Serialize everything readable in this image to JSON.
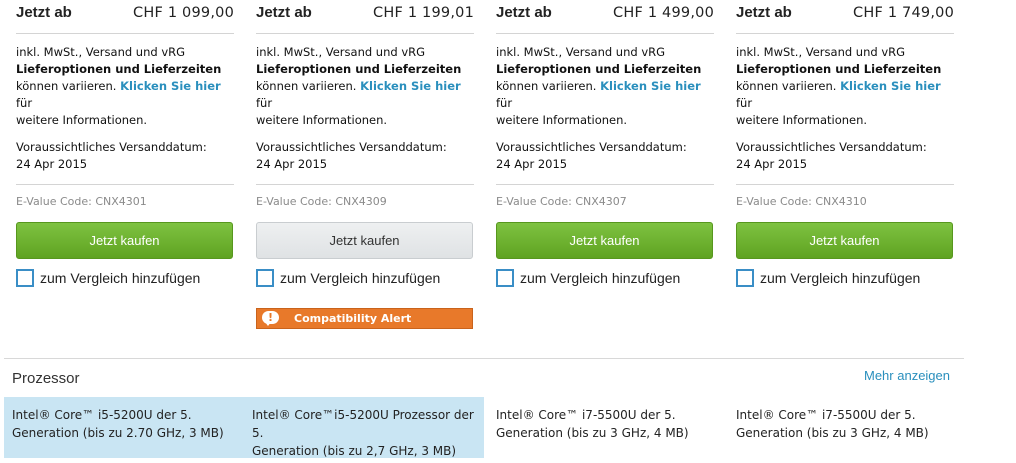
{
  "products": [
    {
      "lead": "Jetzt ab",
      "price": "CHF 1 099,00",
      "info_line1": "inkl. MwSt., Versand und vRG",
      "info_line2": "Lieferoptionen und Lieferzeiten",
      "info_line3_a": "können variieren.",
      "info_link": "Klicken Sie hier",
      "info_line3_b": "für",
      "info_line4": "weitere Informationen.",
      "ship_label": "Voraussichtliches Versanddatum:",
      "ship_date": "24 Apr 2015",
      "ecode": "E-Value Code: CNX4301",
      "buy_label": "Jetzt kaufen",
      "compare_label": "zum Vergleich hinzufügen"
    },
    {
      "lead": "Jetzt ab",
      "price": "CHF 1 199,01",
      "info_line1": "inkl. MwSt., Versand und vRG",
      "info_line2": "Lieferoptionen und Lieferzeiten",
      "info_line3_a": "können variieren.",
      "info_link": "Klicken Sie hier",
      "info_line3_b": "für",
      "info_line4": "weitere Informationen.",
      "ship_label": "Voraussichtliches Versanddatum:",
      "ship_date": "24 Apr 2015",
      "ecode": "E-Value Code: CNX4309",
      "buy_label": "Jetzt kaufen",
      "compare_label": "zum Vergleich hinzufügen",
      "alert_label": "Compatibility Alert",
      "alert_glyph": "!"
    },
    {
      "lead": "Jetzt ab",
      "price": "CHF 1 499,00",
      "info_line1": "inkl. MwSt., Versand und vRG",
      "info_line2": "Lieferoptionen und Lieferzeiten",
      "info_line3_a": "können variieren.",
      "info_link": "Klicken Sie hier",
      "info_line3_b": "für",
      "info_line4": "weitere Informationen.",
      "ship_label": "Voraussichtliches Versanddatum:",
      "ship_date": "24 Apr 2015",
      "ecode": "E-Value Code: CNX4307",
      "buy_label": "Jetzt kaufen",
      "compare_label": "zum Vergleich hinzufügen"
    },
    {
      "lead": "Jetzt ab",
      "price": "CHF 1 749,00",
      "info_line1": "inkl. MwSt., Versand und vRG",
      "info_line2": "Lieferoptionen und Lieferzeiten",
      "info_line3_a": "können variieren.",
      "info_link": "Klicken Sie hier",
      "info_line3_b": "für",
      "info_line4": "weitere Informationen.",
      "ship_label": "Voraussichtliches Versanddatum:",
      "ship_date": "24 Apr 2015",
      "ecode": "E-Value Code: CNX4310",
      "buy_label": "Jetzt kaufen",
      "compare_label": "zum Vergleich hinzufügen"
    }
  ],
  "processor": {
    "title": "Prozessor",
    "more_label": "Mehr anzeigen",
    "cells": [
      {
        "line1": "Intel® Core™ i5-5200U der 5.",
        "line2": "Generation (bis zu 2.70 GHz, 3 MB)"
      },
      {
        "line1": "Intel® Core™i5-5200U Prozessor der 5.",
        "line2": "Generation (bis zu 2,7 GHz, 3 MB)"
      },
      {
        "line1": "Intel® Core™ i7-5500U der 5.",
        "line2": "Generation (bis zu 3 GHz, 4 MB)"
      },
      {
        "line1": "Intel® Core™ i7-5500U der 5.",
        "line2": "Generation (bis zu 3 GHz, 4 MB)"
      }
    ]
  },
  "colors": {
    "buy_green": "#6cb22e",
    "buy_disabled": "#e5e8ea",
    "link_blue": "#2a8fbd",
    "alert_orange": "#e8792a",
    "highlight_blue": "#c9e5f3"
  },
  "icons": {
    "alert": "speech-bubble-exclamation-icon",
    "compare": "checkbox-icon"
  }
}
